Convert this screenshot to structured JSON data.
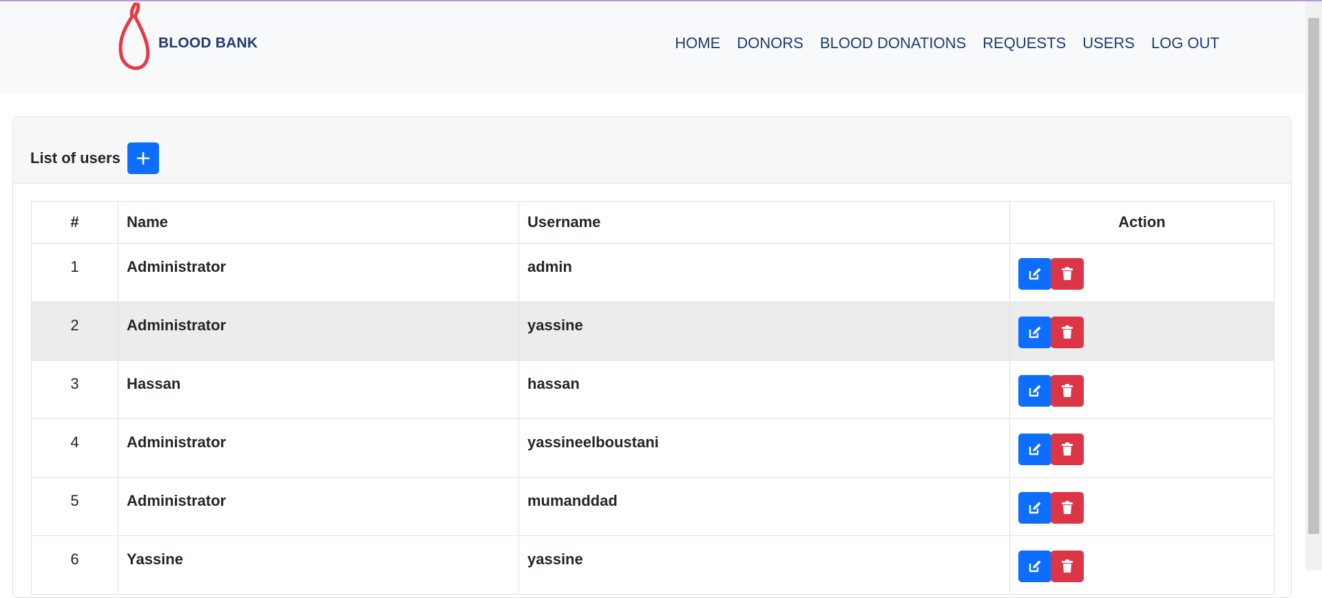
{
  "brand": {
    "name": "BLOOD BANK",
    "logo_icon": "blood-drop-loop-icon",
    "logo_color": "#e63946"
  },
  "nav": {
    "items": [
      {
        "label": "HOME"
      },
      {
        "label": "DONORS"
      },
      {
        "label": "BLOOD DONATIONS"
      },
      {
        "label": "REQUESTS"
      },
      {
        "label": "USERS"
      },
      {
        "label": "LOG OUT"
      }
    ]
  },
  "card": {
    "title": "List of users",
    "add_icon": "plus-icon"
  },
  "table": {
    "columns": {
      "num": "#",
      "name": "Name",
      "username": "Username",
      "action": "Action"
    },
    "rows": [
      {
        "num": "1",
        "name": "Administrator",
        "username": "admin"
      },
      {
        "num": "2",
        "name": "Administrator",
        "username": "yassine"
      },
      {
        "num": "3",
        "name": "Hassan",
        "username": "hassan"
      },
      {
        "num": "4",
        "name": "Administrator",
        "username": "yassineelboustani"
      },
      {
        "num": "5",
        "name": "Administrator",
        "username": "mumanddad"
      },
      {
        "num": "6",
        "name": "Yassine",
        "username": "yassine"
      }
    ],
    "action_icons": {
      "edit": "edit-icon",
      "delete": "trash-icon"
    }
  },
  "colors": {
    "primary": "#0d6efd",
    "danger": "#dc3545",
    "nav_text": "#1f3b73",
    "navbar_bg": "#f8f9fa"
  }
}
